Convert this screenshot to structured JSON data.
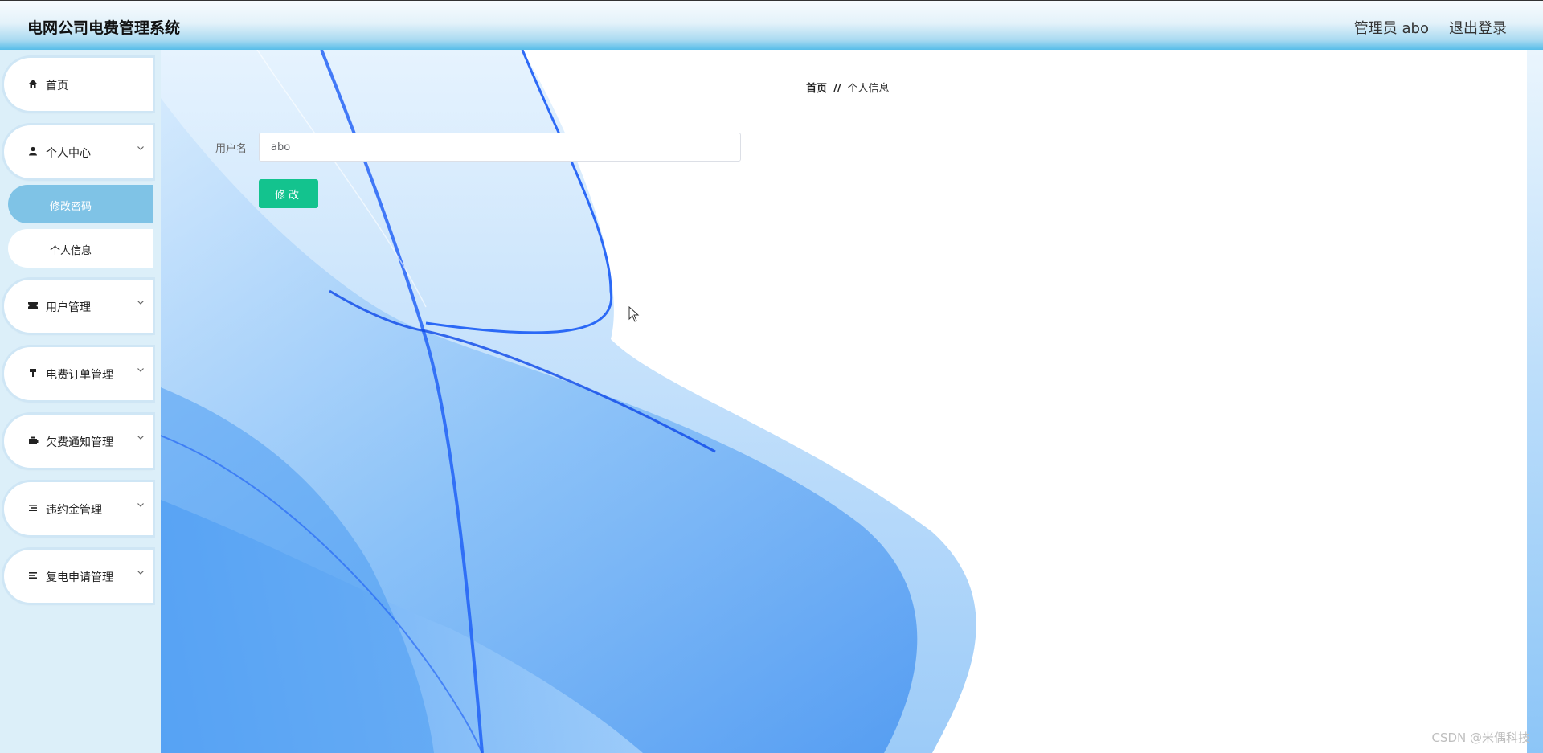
{
  "header": {
    "title": "电网公司电费管理系统",
    "user_label": "管理员 abo",
    "logout_label": "退出登录"
  },
  "sidebar": {
    "items": [
      {
        "label": "首页",
        "icon": "home-icon"
      },
      {
        "label": "个人中心",
        "icon": "user-icon",
        "expanded": true,
        "children": [
          {
            "label": "修改密码",
            "active": true
          },
          {
            "label": "个人信息",
            "active": false
          }
        ]
      },
      {
        "label": "用户管理",
        "icon": "ticket-icon"
      },
      {
        "label": "电费订单管理",
        "icon": "paint-roller-icon"
      },
      {
        "label": "欠费通知管理",
        "icon": "wallet-icon"
      },
      {
        "label": "违约金管理",
        "icon": "list-icon"
      },
      {
        "label": "复电申请管理",
        "icon": "list-icon"
      }
    ]
  },
  "breadcrumb": {
    "home": "首页",
    "separator": "//",
    "current": "个人信息"
  },
  "form": {
    "username_label": "用户名",
    "username_value": "abo",
    "submit_label": "修改"
  },
  "watermark": "CSDN @米偶科技",
  "colors": {
    "accent_button": "#13c38e",
    "active_submenu": "#7fc3e6",
    "sidebar_bg": "#dceff9",
    "wave_blue": "#1a5bf5"
  }
}
